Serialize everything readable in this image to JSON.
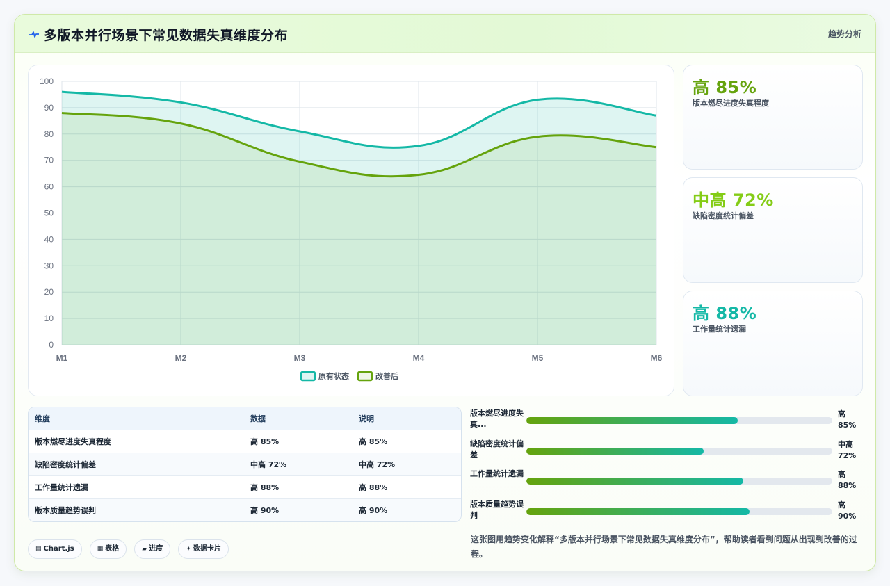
{
  "header": {
    "title": "多版本并行场景下常见数据失真维度分布",
    "trend_link": "趋势分析"
  },
  "colors": {
    "teal": "#14b8a6",
    "green": "#65a30d",
    "lime": "#84cc16"
  },
  "chart_data": {
    "type": "area",
    "x": [
      "M1",
      "M2",
      "M3",
      "M4",
      "M5",
      "M6"
    ],
    "ylim": [
      0,
      100
    ],
    "yticks": [
      "0",
      "10",
      "20",
      "30",
      "40",
      "50",
      "60",
      "70",
      "80",
      "90",
      "100"
    ],
    "grid": true,
    "legend_position": "bottom",
    "series": [
      {
        "name": "原有状态",
        "values": [
          96,
          92,
          81,
          75.5,
          93,
          87
        ],
        "color": "#14b8a6"
      },
      {
        "name": "改善后",
        "values": [
          88,
          84,
          69.5,
          64.5,
          79,
          75
        ],
        "color": "#65a30d"
      }
    ]
  },
  "stat_cards": [
    {
      "value": "高 85%",
      "label": "版本燃尽进度失真程度",
      "color": "#65a30d"
    },
    {
      "value": "中高 72%",
      "label": "缺陷密度统计偏差",
      "color": "#84cc16"
    },
    {
      "value": "高 88%",
      "label": "工作量统计遗漏",
      "color": "#14b8a6"
    }
  ],
  "table": {
    "headers": [
      "维度",
      "数据",
      "说明"
    ],
    "rows": [
      [
        "版本燃尽进度失真程度",
        "高 85%",
        "高 85%"
      ],
      [
        "缺陷密度统计偏差",
        "中高 72%",
        "中高 72%"
      ],
      [
        "工作量统计遗漏",
        "高 88%",
        "高 88%"
      ],
      [
        "版本质量趋势误判",
        "高 90%",
        "高 90%"
      ]
    ]
  },
  "progress": [
    {
      "label": "版本燃尽进度失真...",
      "value_text": "高 85%",
      "fraction": 0.69
    },
    {
      "label": "缺陷密度统计偏差",
      "value_text": "中高 72%",
      "fraction": 0.58
    },
    {
      "label": "工作量统计遗漏",
      "value_text": "高 88%",
      "fraction": 0.71
    },
    {
      "label": "版本质量趋势误判",
      "value_text": "高 90%",
      "fraction": 0.73
    }
  ],
  "chips": [
    {
      "icon": "▤",
      "label": "Chart.js"
    },
    {
      "icon": "▦",
      "label": "表格"
    },
    {
      "icon": "▰",
      "label": "进度"
    },
    {
      "icon": "✦",
      "label": "数据卡片"
    }
  ],
  "description": "这张图用趋势变化解释“多版本并行场景下常见数据失真维度分布”，帮助读者看到问题从出现到改善的过程。"
}
